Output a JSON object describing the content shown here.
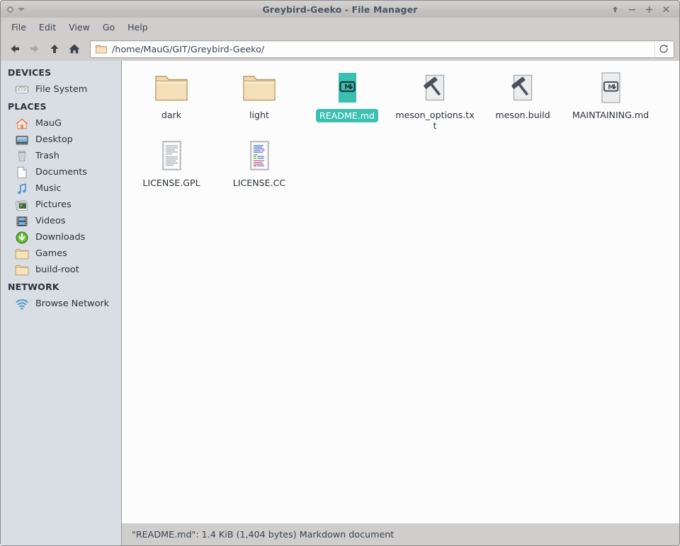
{
  "window": {
    "title": "Greybird-Geeko - File Manager",
    "controls": {
      "menu_icon": "window-menu-icon",
      "caret_icon": "chevron-down-icon",
      "shade": "shade-button",
      "minimize": "minimize-button",
      "maximize": "maximize-button",
      "close": "close-button"
    }
  },
  "menubar": {
    "items": [
      {
        "label": "File",
        "name": "menu-file"
      },
      {
        "label": "Edit",
        "name": "menu-edit"
      },
      {
        "label": "View",
        "name": "menu-view"
      },
      {
        "label": "Go",
        "name": "menu-go"
      },
      {
        "label": "Help",
        "name": "menu-help"
      }
    ]
  },
  "toolbar": {
    "back": {
      "icon": "arrow-left-icon",
      "enabled": true
    },
    "forward": {
      "icon": "arrow-right-icon",
      "enabled": false
    },
    "up": {
      "icon": "arrow-up-icon",
      "enabled": true
    },
    "home": {
      "icon": "home-icon",
      "enabled": true
    },
    "path_icon": "folder-icon",
    "path_value": "/home/MauG/GIT/Greybird-Geeko/",
    "path_placeholder": "Location",
    "reload": {
      "icon": "reload-icon"
    }
  },
  "sidebar": {
    "groups": [
      {
        "heading": "DEVICES",
        "items": [
          {
            "label": "File System",
            "icon": "harddisk-icon",
            "name": "sidebar-item-file-system"
          }
        ]
      },
      {
        "heading": "PLACES",
        "items": [
          {
            "label": "MauG",
            "icon": "home-icon",
            "name": "sidebar-item-maug"
          },
          {
            "label": "Desktop",
            "icon": "desktop-icon",
            "name": "sidebar-item-desktop"
          },
          {
            "label": "Trash",
            "icon": "trash-icon",
            "name": "sidebar-item-trash"
          },
          {
            "label": "Documents",
            "icon": "document-icon",
            "name": "sidebar-item-documents"
          },
          {
            "label": "Music",
            "icon": "music-note-icon",
            "name": "sidebar-item-music"
          },
          {
            "label": "Pictures",
            "icon": "pictures-icon",
            "name": "sidebar-item-pictures"
          },
          {
            "label": "Videos",
            "icon": "film-icon",
            "name": "sidebar-item-videos"
          },
          {
            "label": "Downloads",
            "icon": "download-icon",
            "name": "sidebar-item-downloads"
          },
          {
            "label": "Games",
            "icon": "folder-icon",
            "name": "sidebar-item-games"
          },
          {
            "label": "build-root",
            "icon": "folder-icon",
            "name": "sidebar-item-build-root"
          }
        ]
      },
      {
        "heading": "NETWORK",
        "items": [
          {
            "label": "Browse Network",
            "icon": "network-icon",
            "name": "sidebar-item-browse-network"
          }
        ]
      }
    ]
  },
  "files": [
    {
      "name": "dark",
      "icon": "folder-icon",
      "selected": false
    },
    {
      "name": "light",
      "icon": "folder-icon",
      "selected": false
    },
    {
      "name": "README.md",
      "icon": "markdown-icon",
      "selected": true
    },
    {
      "name": "meson_options.txt",
      "icon": "build-hammer-icon",
      "selected": false
    },
    {
      "name": "meson.build",
      "icon": "build-hammer-icon",
      "selected": false
    },
    {
      "name": "MAINTAINING.md",
      "icon": "markdown-icon",
      "selected": false
    },
    {
      "name": "LICENSE.GPL",
      "icon": "text-document-icon",
      "selected": false
    },
    {
      "name": "LICENSE.CC",
      "icon": "source-document-icon",
      "selected": false
    }
  ],
  "statusbar": {
    "text": "\"README.md\": 1.4 KiB (1,404 bytes) Markdown document"
  },
  "colors": {
    "selection_teal": "#3cbfb0",
    "sidebar_bg": "#d9dde4",
    "chrome_bg": "#cfcecc",
    "pane_bg": "#fcfcfc",
    "text": "#2c313a"
  }
}
